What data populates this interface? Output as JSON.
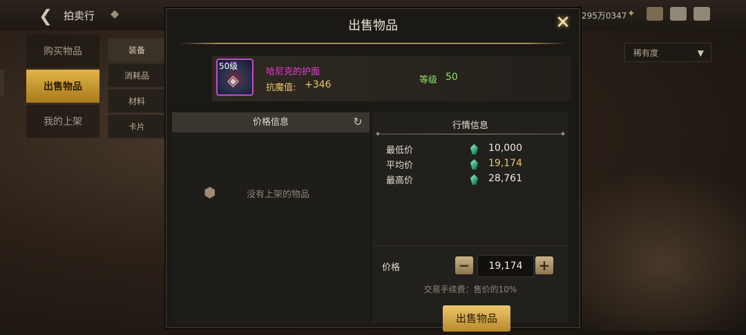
{
  "topbar": {
    "title": "拍卖行",
    "currency": "295万0347"
  },
  "left_nav": {
    "items": [
      {
        "label": "购买物品"
      },
      {
        "label": "出售物品"
      },
      {
        "label": "我的上架"
      }
    ]
  },
  "sub_nav": {
    "items": [
      {
        "label": "装备"
      },
      {
        "label": "消耗品"
      },
      {
        "label": "材料"
      },
      {
        "label": "卡片"
      }
    ]
  },
  "filter": {
    "label": "稀有度"
  },
  "dialog": {
    "title": "出售物品",
    "item": {
      "level_badge": "50级",
      "name": "哈尼克的护面",
      "stat_label": "抗魔值:",
      "stat_value": "+346",
      "level_label": "等级",
      "level_value": "50"
    },
    "price_info": {
      "header": "价格信息",
      "empty_text": "没有上架的物品"
    },
    "market_info": {
      "header": "行情信息",
      "rows": [
        {
          "label": "最低价",
          "value": "10,000"
        },
        {
          "label": "平均价",
          "value": "19,174"
        },
        {
          "label": "最高价",
          "value": "28,761"
        }
      ]
    },
    "price": {
      "label": "价格",
      "value": "19,174",
      "minus": "−",
      "plus": "+"
    },
    "fee_text": "交易手续费：售价的10%",
    "sell_button": "出售物品"
  },
  "colors": {
    "accent_gold": "#e3b548",
    "item_purple": "#e93fd8",
    "stat_yellow": "#e9c86a",
    "level_green": "#8fe56a"
  }
}
